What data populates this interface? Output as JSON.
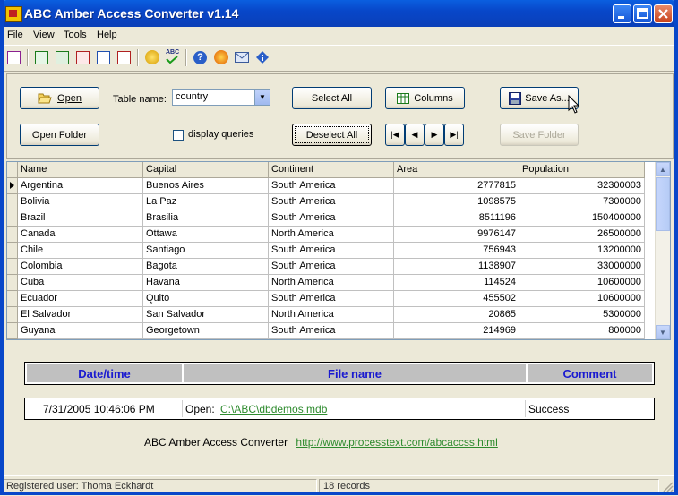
{
  "window": {
    "title": "ABC Amber Access Converter v1.14"
  },
  "menu": [
    "File",
    "View",
    "Tools",
    "Help"
  ],
  "controls": {
    "open_label": "Open",
    "open_folder_label": "Open Folder",
    "table_name_label": "Table name:",
    "table_name_value": "country",
    "display_queries_label": "display queries",
    "select_all_label": "Select All",
    "deselect_all_label": "Deselect All",
    "columns_label": "Columns",
    "save_as_label": "Save As...",
    "save_folder_label": "Save Folder"
  },
  "grid": {
    "columns": [
      "Name",
      "Capital",
      "Continent",
      "Area",
      "Population"
    ],
    "rows": [
      [
        "Argentina",
        "Buenos Aires",
        "South America",
        "2777815",
        "32300003"
      ],
      [
        "Bolivia",
        "La Paz",
        "South America",
        "1098575",
        "7300000"
      ],
      [
        "Brazil",
        "Brasilia",
        "South America",
        "8511196",
        "150400000"
      ],
      [
        "Canada",
        "Ottawa",
        "North America",
        "9976147",
        "26500000"
      ],
      [
        "Chile",
        "Santiago",
        "South America",
        "756943",
        "13200000"
      ],
      [
        "Colombia",
        "Bagota",
        "South America",
        "1138907",
        "33000000"
      ],
      [
        "Cuba",
        "Havana",
        "North America",
        "114524",
        "10600000"
      ],
      [
        "Ecuador",
        "Quito",
        "South America",
        "455502",
        "10600000"
      ],
      [
        "El Salvador",
        "San Salvador",
        "North America",
        "20865",
        "5300000"
      ],
      [
        "Guyana",
        "Georgetown",
        "South America",
        "214969",
        "800000"
      ]
    ]
  },
  "log": {
    "headers": [
      "Date/time",
      "File name",
      "Comment"
    ],
    "rows": [
      {
        "datetime": "7/31/2005 10:46:06 PM",
        "action": "Open:",
        "file": "C:\\ABC\\dbdemos.mdb",
        "comment": "Success"
      }
    ]
  },
  "footer": {
    "product": "ABC Amber Access Converter",
    "url": "http://www.processtext.com/abcaccss.html"
  },
  "status": {
    "user": "Registered user: Thoma Eckhardt",
    "records": "18 records"
  }
}
